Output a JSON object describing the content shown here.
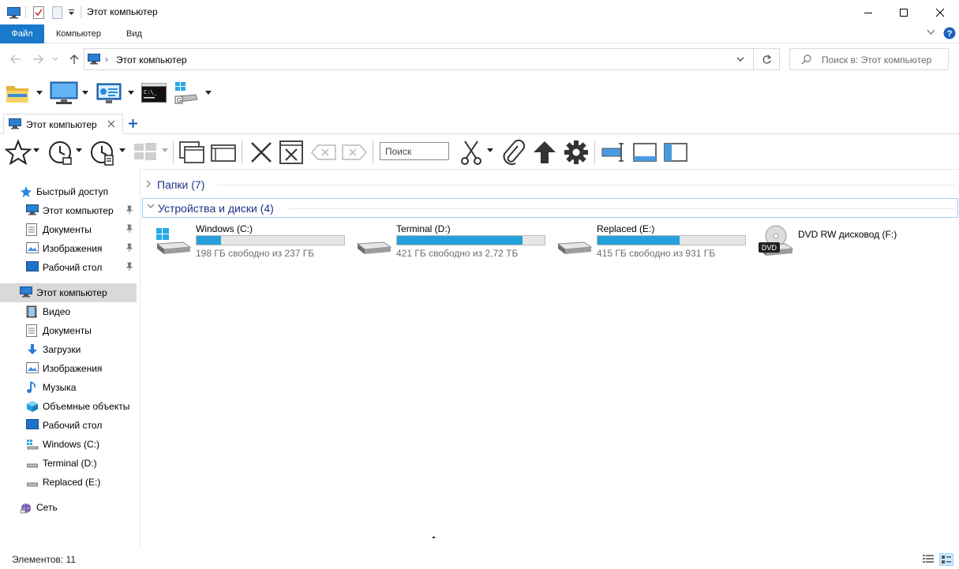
{
  "window": {
    "title": "Этот компьютер"
  },
  "ribbon": {
    "tabs": [
      "Файл",
      "Компьютер",
      "Вид"
    ]
  },
  "address": {
    "path": "Этот компьютер",
    "search_placeholder": "Поиск в: Этот компьютер"
  },
  "tab": {
    "label": "Этот компьютер"
  },
  "toolbar": {
    "quick_search_placeholder": "Поиск"
  },
  "sidebar": {
    "quick_access": "Быстрый доступ",
    "pinned": [
      "Этот компьютер",
      "Документы",
      "Изображения",
      "Рабочий стол"
    ],
    "this_pc": "Этот компьютер",
    "pc_items": [
      "Видео",
      "Документы",
      "Загрузки",
      "Изображения",
      "Музыка",
      "Объемные объекты",
      "Рабочий стол",
      "Windows (C:)",
      "Terminal (D:)",
      "Replaced (E:)"
    ],
    "network": "Сеть"
  },
  "groups": {
    "folders": "Папки (7)",
    "devices": "Устройства и диски (4)"
  },
  "drives": [
    {
      "name": "Windows (C:)",
      "free": "198 ГБ свободно из 237 ГБ",
      "used_fraction": 0.165
    },
    {
      "name": "Terminal (D:)",
      "free": "421 ГБ свободно из 2,72 ТБ",
      "used_fraction": 0.849
    },
    {
      "name": "Replaced (E:)",
      "free": "415 ГБ свободно из 931 ГБ",
      "used_fraction": 0.554
    },
    {
      "name": "DVD RW дисковод (F:)",
      "disc_label": "DVD"
    }
  ],
  "status": {
    "count": "Элементов: 11"
  },
  "colors": {
    "accent": "#1979ca",
    "bar_fill": "#26a0da",
    "group_title": "#1e3287"
  }
}
